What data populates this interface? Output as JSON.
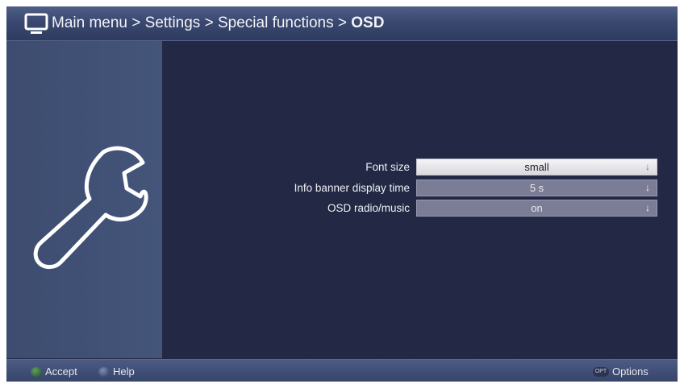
{
  "header": {
    "breadcrumb": [
      "Main menu",
      "Settings",
      "Special functions",
      "OSD"
    ],
    "separator": " > "
  },
  "settings": [
    {
      "label": "Font size",
      "value": "small",
      "selected": true
    },
    {
      "label": "Info banner display time",
      "value": "5 s",
      "selected": false
    },
    {
      "label": "OSD radio/music",
      "value": "on",
      "selected": false
    }
  ],
  "footer": {
    "accept_label": "Accept",
    "help_label": "Help",
    "options_badge": "OPT",
    "options_label": "Options"
  },
  "icons": {
    "header": "tv-icon",
    "side_panel": "wrench-icon"
  },
  "colors": {
    "background": "#232945",
    "side_panel": "#41516f",
    "selected_field": "#e9e9ec",
    "unselected_field": "#7b7d96"
  }
}
